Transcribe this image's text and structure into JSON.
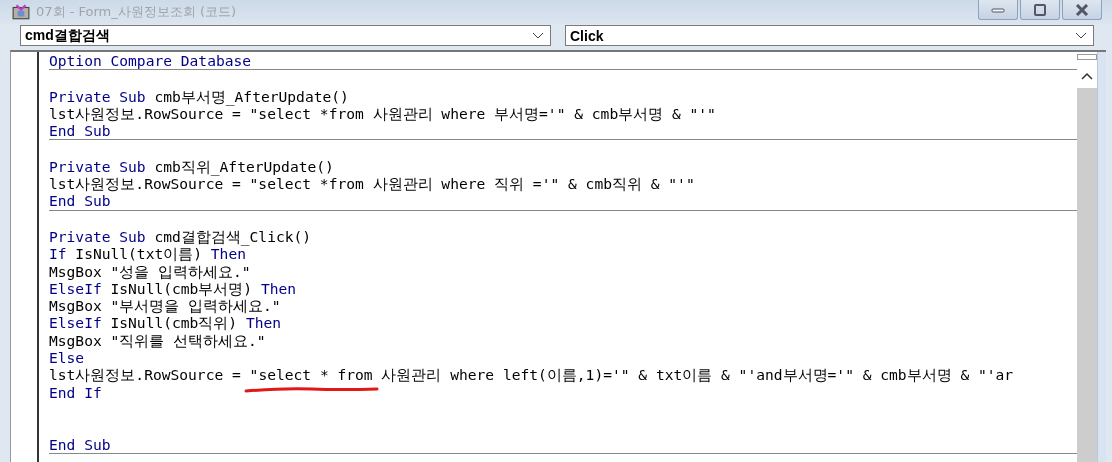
{
  "window": {
    "title": "07회 - Form_사원정보조회 (코드)"
  },
  "object_combo": {
    "value": "cmd결합검색"
  },
  "procedure_combo": {
    "value": "Click"
  },
  "code": {
    "blocks": [
      {
        "lines": [
          {
            "kind": "code",
            "tokens": [
              {
                "kind": "keyword",
                "text": "Option Compare Database"
              }
            ]
          }
        ]
      },
      {
        "lines": [
          {
            "kind": "blank"
          },
          {
            "kind": "code",
            "tokens": [
              {
                "kind": "keyword",
                "text": "Private Sub"
              },
              {
                "kind": "plain",
                "text": " cmb부서명_AfterUpdate()"
              }
            ]
          },
          {
            "kind": "code",
            "tokens": [
              {
                "kind": "plain",
                "text": "lst사원정보.RowSource = \"select *from 사원관리 where 부서명='\" & cmb부서명 & \"'\""
              }
            ]
          },
          {
            "kind": "code",
            "tokens": [
              {
                "kind": "keyword",
                "text": "End Sub"
              }
            ]
          }
        ]
      },
      {
        "lines": [
          {
            "kind": "blank"
          },
          {
            "kind": "code",
            "tokens": [
              {
                "kind": "keyword",
                "text": "Private Sub"
              },
              {
                "kind": "plain",
                "text": " cmb직위_AfterUpdate()"
              }
            ]
          },
          {
            "kind": "code",
            "tokens": [
              {
                "kind": "plain",
                "text": "lst사원정보.RowSource = \"select *from 사원관리 where 직위 ='\" & cmb직위 & \"'\""
              }
            ]
          },
          {
            "kind": "code",
            "tokens": [
              {
                "kind": "keyword",
                "text": "End Sub"
              }
            ]
          }
        ]
      },
      {
        "lines": [
          {
            "kind": "blank"
          },
          {
            "kind": "code",
            "tokens": [
              {
                "kind": "keyword",
                "text": "Private Sub"
              },
              {
                "kind": "plain",
                "text": " cmd결합검색_Click()"
              }
            ]
          },
          {
            "kind": "code",
            "tokens": [
              {
                "kind": "keyword",
                "text": "If"
              },
              {
                "kind": "plain",
                "text": " IsNull(txt이름) "
              },
              {
                "kind": "keyword",
                "text": "Then"
              }
            ]
          },
          {
            "kind": "code",
            "tokens": [
              {
                "kind": "plain",
                "text": "MsgBox \"성을 입력하세요.\""
              }
            ]
          },
          {
            "kind": "code",
            "tokens": [
              {
                "kind": "keyword",
                "text": "ElseIf"
              },
              {
                "kind": "plain",
                "text": " IsNull(cmb부서명) "
              },
              {
                "kind": "keyword",
                "text": "Then"
              }
            ]
          },
          {
            "kind": "code",
            "tokens": [
              {
                "kind": "plain",
                "text": "MsgBox \"부서명을 입력하세요.\""
              }
            ]
          },
          {
            "kind": "code",
            "tokens": [
              {
                "kind": "keyword",
                "text": "ElseIf"
              },
              {
                "kind": "plain",
                "text": " IsNull(cmb직위) "
              },
              {
                "kind": "keyword",
                "text": "Then"
              }
            ]
          },
          {
            "kind": "code",
            "tokens": [
              {
                "kind": "plain",
                "text": "MsgBox \"직위를 선택하세요.\""
              }
            ]
          },
          {
            "kind": "code",
            "tokens": [
              {
                "kind": "keyword",
                "text": "Else"
              }
            ]
          },
          {
            "kind": "code",
            "tokens": [
              {
                "kind": "plain",
                "text": "lst사원정보.RowSource = "
              },
              {
                "kind": "plain",
                "text": "\"select * from",
                "underlined": true
              },
              {
                "kind": "plain",
                "text": " 사원관리 where left(이름,1)='\" & txt이름 & \"'and부서명='\" & cmb부서명 & \"'ar"
              }
            ]
          },
          {
            "kind": "code",
            "tokens": [
              {
                "kind": "keyword",
                "text": "End If"
              }
            ]
          },
          {
            "kind": "blank"
          },
          {
            "kind": "blank"
          },
          {
            "kind": "code",
            "tokens": [
              {
                "kind": "keyword",
                "text": "End Sub"
              }
            ]
          }
        ]
      }
    ]
  }
}
